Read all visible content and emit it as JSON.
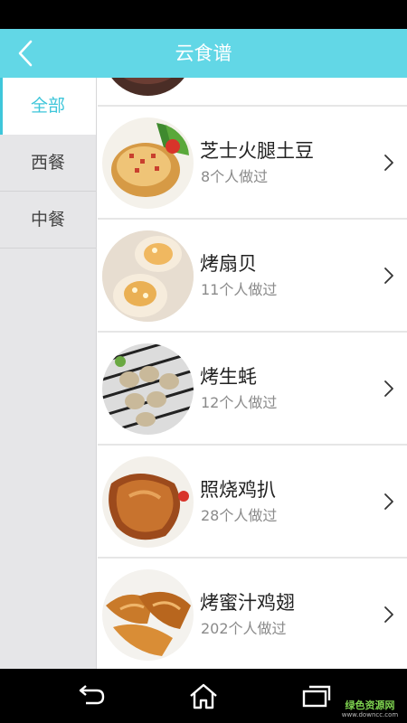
{
  "header": {
    "title": "云食谱"
  },
  "sidebar": {
    "items": [
      {
        "label": "全部",
        "active": true
      },
      {
        "label": "西餐",
        "active": false
      },
      {
        "label": "中餐",
        "active": false
      }
    ]
  },
  "recipes": [
    {
      "name": "",
      "count": ""
    },
    {
      "name": "芝士火腿土豆",
      "count": "8个人做过"
    },
    {
      "name": "烤扇贝",
      "count": "11个人做过"
    },
    {
      "name": "烤生蚝",
      "count": "12个人做过"
    },
    {
      "name": "照烧鸡扒",
      "count": "28个人做过"
    },
    {
      "name": "烤蜜汁鸡翅",
      "count": "202个人做过"
    }
  ],
  "navbar": {
    "back": "back-icon",
    "home": "home-icon",
    "recents": "recents-icon"
  },
  "watermark": {
    "main": "绿色资源网",
    "sub": "www.downcc.com"
  },
  "colors": {
    "accent": "#3ec6da",
    "appbar": "#62d7e6",
    "sidebar_bg": "#e6e6e8"
  }
}
